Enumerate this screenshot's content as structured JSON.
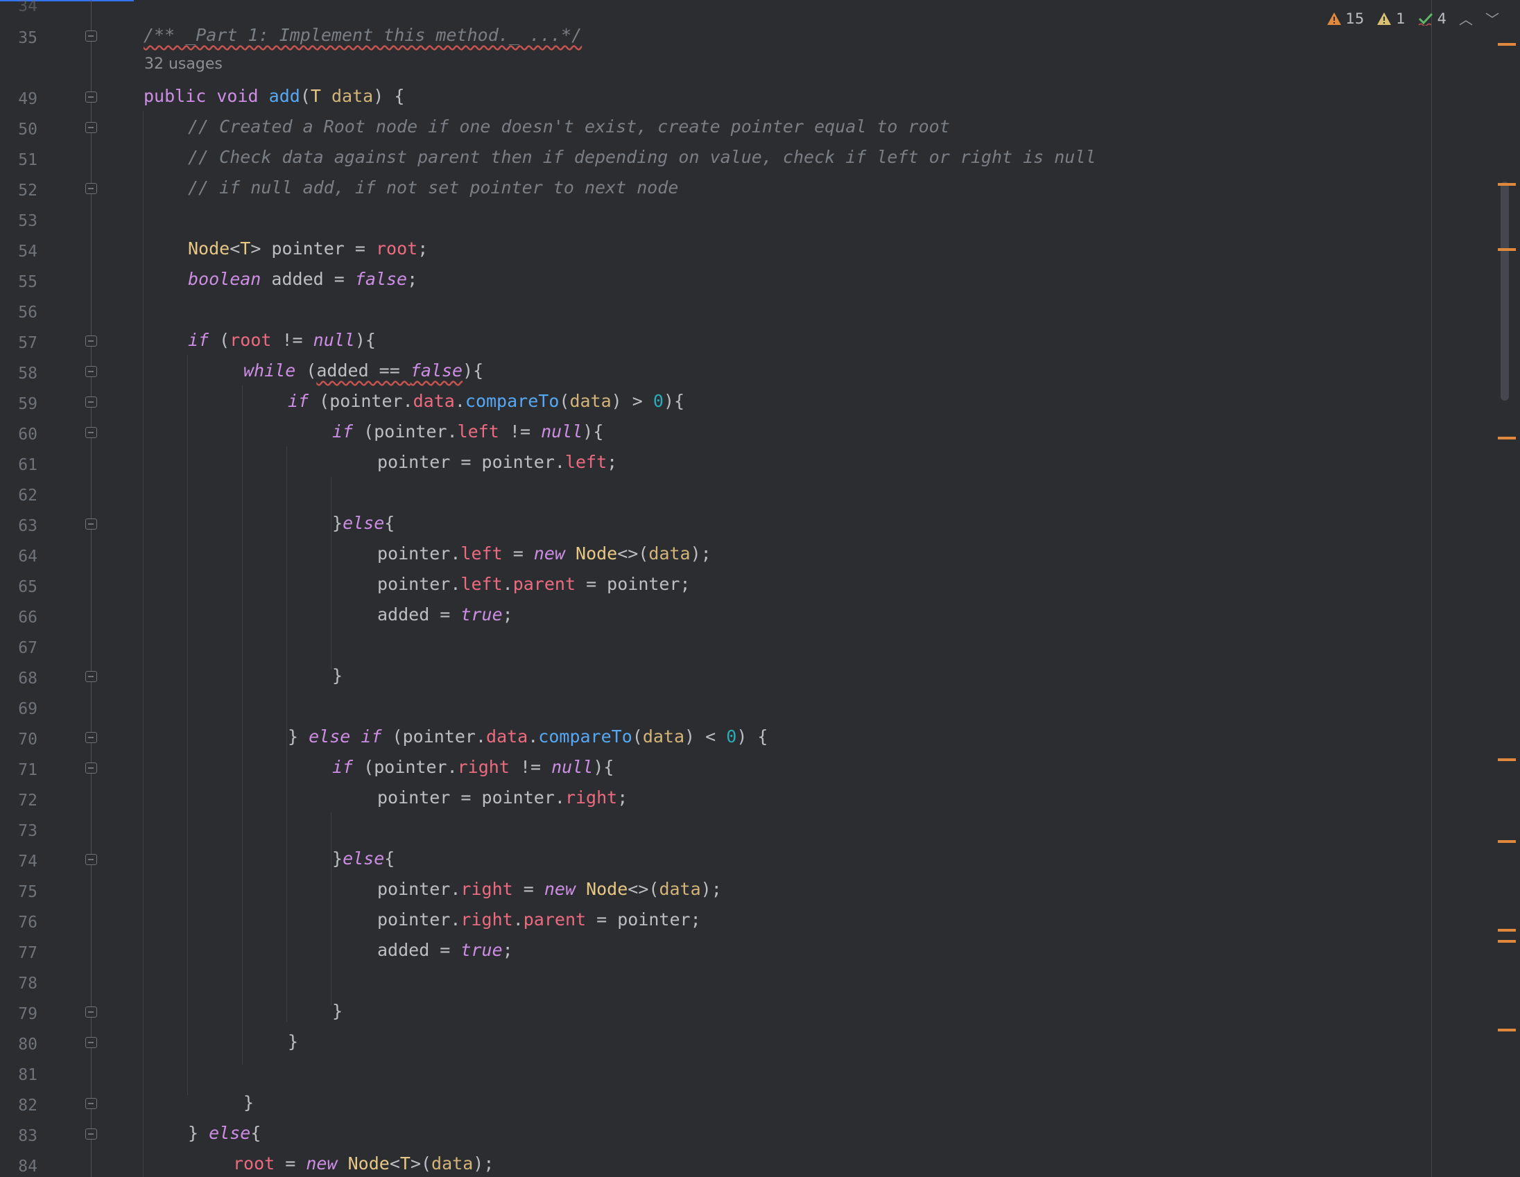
{
  "status": {
    "warnings": "15",
    "weak_warnings": "1",
    "typos": "4",
    "colors": {
      "warning": "#e0893c",
      "weak": "#d7c171",
      "typo": "#5fb865"
    }
  },
  "usages": "32 usages",
  "line_numbers": [
    "34",
    "35",
    "49",
    "50",
    "51",
    "52",
    "53",
    "54",
    "55",
    "56",
    "57",
    "58",
    "59",
    "60",
    "61",
    "62",
    "63",
    "64",
    "65",
    "66",
    "67",
    "68",
    "69",
    "70",
    "71",
    "72",
    "73",
    "74",
    "75",
    "76",
    "77",
    "78",
    "79",
    "80",
    "81",
    "82",
    "83",
    "84"
  ],
  "code": {
    "l35_doc": "/** _Part 1: Implement this method._ ...*/",
    "l49": {
      "k1": "public",
      "k2": "void",
      "fn": "add",
      "p1": "(",
      "type": "T",
      "param": "data",
      "p2": ") {"
    },
    "l50": "// Created a Root node if one doesn't exist, create pointer equal to root",
    "l51": "// Check data against parent then if depending on value, check if left or right is null",
    "l52": "// if null add, if not set pointer to next node",
    "l54": {
      "type": "Node",
      "gen_open": "<",
      "gen": "T",
      "gen_close": ">",
      "mid": " pointer = ",
      "field": "root",
      "end": ";"
    },
    "l55": {
      "kw": "boolean",
      "mid": " added = ",
      "val": "false",
      "end": ";"
    },
    "l57": {
      "kw": "if",
      "p1": " (",
      "field": "root",
      "mid": " != ",
      "val": "null",
      "end": "){"
    },
    "l58": {
      "kw": "while",
      "p1": " (",
      "sq1": "added == ",
      "sq2": "false",
      "end": "){"
    },
    "l59": {
      "kw": "if",
      "a": " (pointer.",
      "field": "data",
      "dot": ".",
      "fn": "compareTo",
      "p": "(",
      "param": "data",
      "mid": ") > ",
      "num": "0",
      "end": "){"
    },
    "l60": {
      "kw": "if",
      "a": " (pointer.",
      "field": "left",
      "mid": " != ",
      "val": "null",
      "end": "){"
    },
    "l61": {
      "a": "pointer = pointer.",
      "field": "left",
      "end": ";"
    },
    "l63": {
      "a": "}",
      "kw": "else",
      "end": "{"
    },
    "l64": {
      "a": "pointer.",
      "field": "left",
      "mid": " = ",
      "kw": "new",
      "sp": " ",
      "type": "Node",
      "d": "<>(",
      "param": "data",
      "end": ");"
    },
    "l65": {
      "a": "pointer.",
      "field1": "left",
      "dot": ".",
      "field2": "parent",
      "end": " = pointer;"
    },
    "l66": {
      "a": "added = ",
      "val": "true",
      "end": ";"
    },
    "l68": "}",
    "l70": {
      "a": "} ",
      "kw1": "else",
      "sp": " ",
      "kw2": "if",
      "b": " (pointer.",
      "field": "data",
      "dot": ".",
      "fn": "compareTo",
      "p": "(",
      "param": "data",
      "mid": ") < ",
      "num": "0",
      "end": ") {"
    },
    "l71": {
      "kw": "if",
      "a": " (pointer.",
      "field": "right",
      "mid": " != ",
      "val": "null",
      "end": "){"
    },
    "l72": {
      "a": "pointer = pointer.",
      "field": "right",
      "end": ";"
    },
    "l74": {
      "a": "}",
      "kw": "else",
      "end": "{"
    },
    "l75": {
      "a": "pointer.",
      "field": "right",
      "mid": " = ",
      "kw": "new",
      "sp": " ",
      "type": "Node",
      "d": "<>(",
      "param": "data",
      "end": ");"
    },
    "l76": {
      "a": "pointer.",
      "field1": "right",
      "dot": ".",
      "field2": "parent",
      "end": " = pointer;"
    },
    "l77": {
      "a": "added = ",
      "val": "true",
      "end": ";"
    },
    "l79": "}",
    "l80": "}",
    "l82": "}",
    "l83": {
      "a": "} ",
      "kw": "else",
      "end": "{"
    },
    "l84": {
      "field": "root",
      "mid": " = ",
      "kw": "new",
      "sp": " ",
      "type": "Node",
      "gen_open": "<",
      "gen": "T",
      "gen_close": ">(",
      "param": "data",
      "end": ");"
    }
  }
}
